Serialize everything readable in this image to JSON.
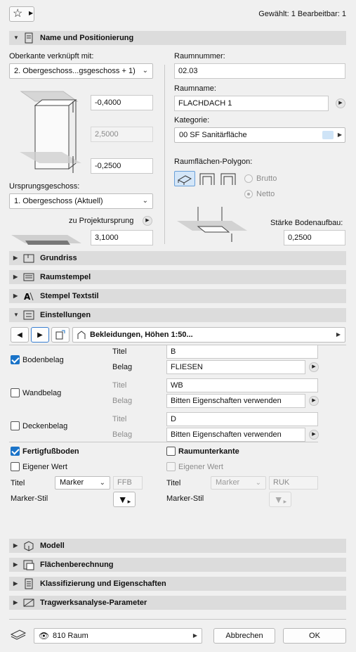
{
  "header": {
    "star_icon": "star-icon",
    "status": "Gewählt: 1 Bearbeitbar: 1"
  },
  "sec_name": {
    "title": "Name und Positionierung",
    "top_link_label": "Oberkante verknüpft mit:",
    "top_link_value": "2. Obergeschoss...gsgeschoss + 1)",
    "top_offset": "-0,4000",
    "height": "2,5000",
    "bottom_offset": "-0,2500",
    "home_story_label": "Ursprungsgeschoss:",
    "home_story_value": "1. Obergeschoss (Aktuell)",
    "to_origin_label": "zu Projektursprung",
    "to_origin_value": "3,1000",
    "room_number_label": "Raumnummer:",
    "room_number": "02.03",
    "room_name_label": "Raumname:",
    "room_name": "FLACHDACH 1",
    "category_label": "Kategorie:",
    "category_value": "00 SF   Sanitärfläche",
    "category_color": "#cfe4f7",
    "polygon_label": "Raumflächen-Polygon:",
    "brutto": "Brutto",
    "netto": "Netto",
    "floor_thickness_label": "Stärke Bodenaufbau:",
    "floor_thickness": "0,2500"
  },
  "sections_mid": [
    {
      "label": "Grundriss",
      "icon": "floorplan-icon"
    },
    {
      "label": "Raumstempel",
      "icon": "zone-stamp-icon"
    },
    {
      "label": "Stempel Textstil",
      "icon": "text-style-icon"
    },
    {
      "label": "Einstellungen",
      "icon": "settings-icon"
    }
  ],
  "einstellungen": {
    "preset": "Bekleidungen, Höhen 1:50...",
    "rows": [
      {
        "name": "Bodenbelag",
        "checked": true,
        "titel_label": "Titel",
        "titel": "B",
        "belag_label": "Belag",
        "belag": "FLIESEN"
      },
      {
        "name": "Wandbelag",
        "checked": false,
        "titel_label": "Titel",
        "titel": "WB",
        "belag_label": "Belag",
        "belag": "Bitten Eigenschaften verwenden"
      },
      {
        "name": "Deckenbelag",
        "checked": false,
        "titel_label": "Titel",
        "titel": "D",
        "belag_label": "Belag",
        "belag": "Bitten Eigenschaften verwenden"
      }
    ],
    "left": {
      "title": "Fertigfußboden",
      "own_value": "Eigener Wert",
      "titel_label": "Titel",
      "marker": "Marker",
      "code": "FFB",
      "marker_style_label": "Marker-Stil"
    },
    "right": {
      "title": "Raumunterkante",
      "own_value": "Eigener Wert",
      "titel_label": "Titel",
      "marker": "Marker",
      "code": "RUK",
      "marker_style_label": "Marker-Stil"
    }
  },
  "sections_bottom": [
    {
      "label": "Modell",
      "icon": "model-icon"
    },
    {
      "label": "Flächenberechnung",
      "icon": "area-calc-icon"
    },
    {
      "label": "Klassifizierung und Eigenschaften",
      "icon": "classification-icon"
    },
    {
      "label": "Tragwerksanalyse-Parameter",
      "icon": "structural-icon"
    }
  ],
  "footer": {
    "layer": "810 Raum",
    "cancel": "Abbrechen",
    "ok": "OK"
  }
}
